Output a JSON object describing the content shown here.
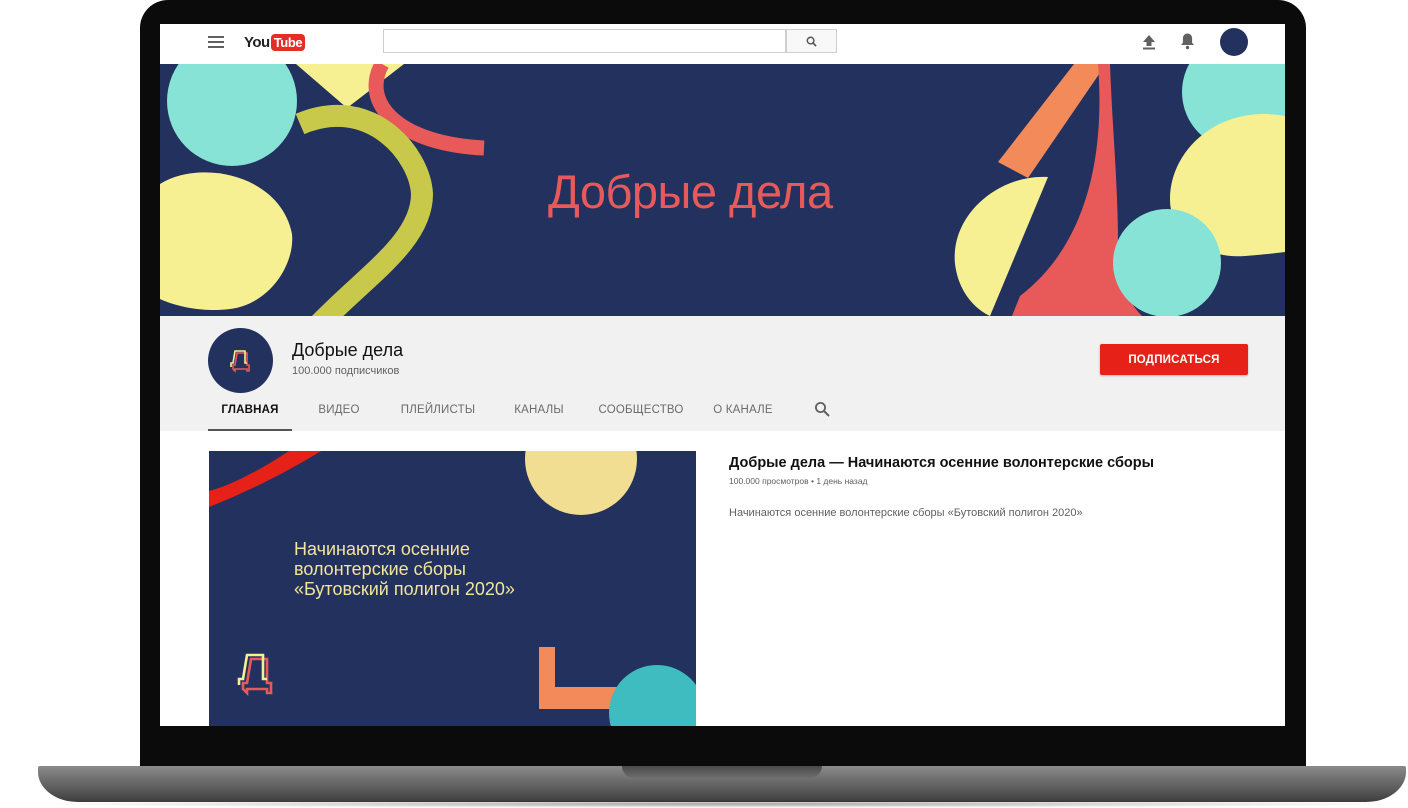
{
  "topbar": {
    "logo_you": "You",
    "logo_tube": "Tube",
    "search_placeholder": ""
  },
  "banner": {
    "title": "Добрые дела",
    "colors": {
      "background": "#23315f",
      "teal": "#86e3d6",
      "yellow": "#f6f093",
      "red": "#e85a5a",
      "olive": "#c8c94a",
      "orange": "#f28a5a"
    }
  },
  "channel": {
    "name": "Добрые дела",
    "subscribers": "100.000 подписчиков",
    "subscribe_label": "ПОДПИСАТЬСЯ",
    "tabs": [
      {
        "label": "ГЛАВНАЯ",
        "active": true
      },
      {
        "label": "ВИДЕО",
        "active": false
      },
      {
        "label": "ПЛЕЙЛИСТЫ",
        "active": false
      },
      {
        "label": "КАНАЛЫ",
        "active": false
      },
      {
        "label": "СООБЩЕСТВО",
        "active": false
      },
      {
        "label": "О КАНАЛЕ",
        "active": false
      }
    ]
  },
  "featured": {
    "thumb_lines": [
      "Начинаются осенние",
      "волонтерские сборы",
      "«Бутовский полигон 2020»"
    ],
    "title": "Добрые дела — Начинаются осенние волонтерские сборы",
    "meta": "100.000 просмотров • 1 день назад",
    "description": "Начинаются осенние волонтерские сборы «Бутовский полигон 2020»"
  },
  "icons": {
    "menu": "menu-icon",
    "search": "search-icon",
    "upload": "upload-icon",
    "notifications": "bell-icon",
    "account": "avatar"
  }
}
